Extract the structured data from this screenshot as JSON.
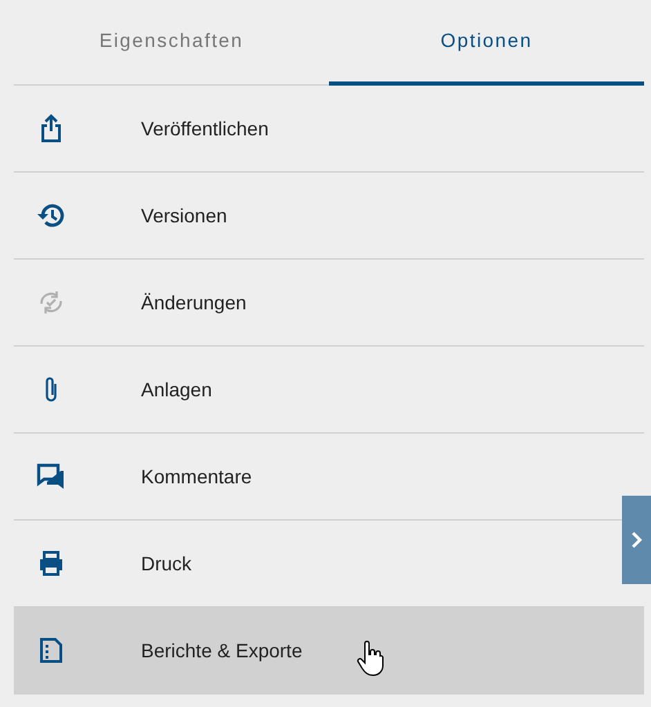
{
  "tabs": [
    {
      "label": "Eigenschaften",
      "selected": false
    },
    {
      "label": "Optionen",
      "selected": true
    }
  ],
  "items": [
    {
      "label": "Veröffentlichen",
      "disabled": false,
      "hovered": false
    },
    {
      "label": "Versionen",
      "disabled": false,
      "hovered": false
    },
    {
      "label": "Änderungen",
      "disabled": true,
      "hovered": false
    },
    {
      "label": "Anlagen",
      "disabled": false,
      "hovered": false
    },
    {
      "label": "Kommentare",
      "disabled": false,
      "hovered": false
    },
    {
      "label": "Druck",
      "disabled": false,
      "hovered": false
    },
    {
      "label": "Berichte & Exporte",
      "disabled": false,
      "hovered": true
    }
  ]
}
